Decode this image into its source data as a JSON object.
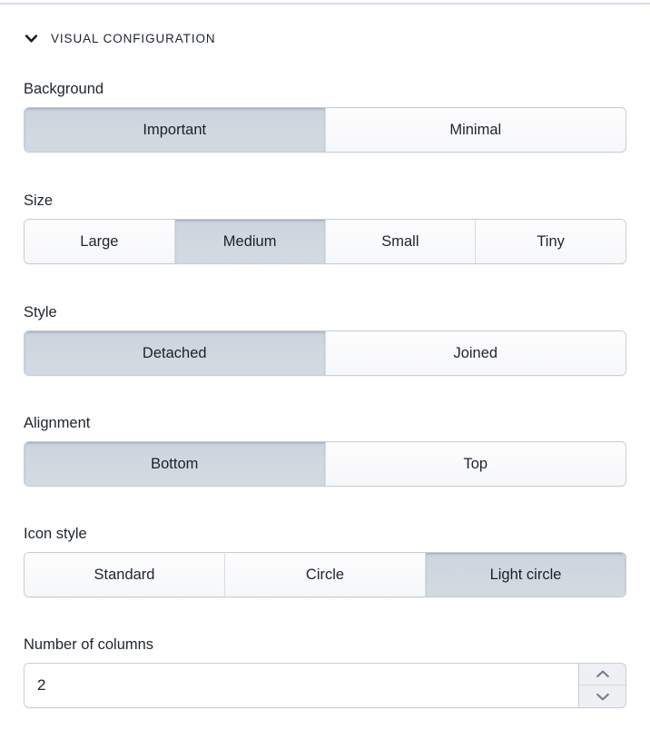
{
  "panel": {
    "header": {
      "title": "VISUAL CONFIGURATION",
      "chevron_icon": "chevron-down-icon",
      "expanded": true
    },
    "colors": {
      "selected_segment_bg": "#ccd5de",
      "unselected_segment_bg": "#f8f9fb",
      "border": "#c9ced6",
      "label_text": "#1e252e",
      "divider": "#d3dce6",
      "stepper_bg": "#eef0f3",
      "stepper_chevron": "#6f7d8c"
    },
    "fields": [
      {
        "label": "Background",
        "type": "segmented",
        "options": [
          "Important",
          "Minimal"
        ],
        "selected": "Important"
      },
      {
        "label": "Size",
        "type": "segmented",
        "options": [
          "Large",
          "Medium",
          "Small",
          "Tiny"
        ],
        "selected": "Medium"
      },
      {
        "label": "Style",
        "type": "segmented",
        "options": [
          "Detached",
          "Joined"
        ],
        "selected": "Detached"
      },
      {
        "label": "Alignment",
        "type": "segmented",
        "options": [
          "Bottom",
          "Top"
        ],
        "selected": "Bottom"
      },
      {
        "label": "Icon style",
        "type": "segmented",
        "options": [
          "Standard",
          "Circle",
          "Light circle"
        ],
        "selected": "Light circle"
      },
      {
        "label": "Number of columns",
        "type": "number",
        "value": "2",
        "placeholder": "",
        "increment_icon": "chevron-up-icon",
        "decrement_icon": "chevron-down-icon"
      }
    ]
  }
}
